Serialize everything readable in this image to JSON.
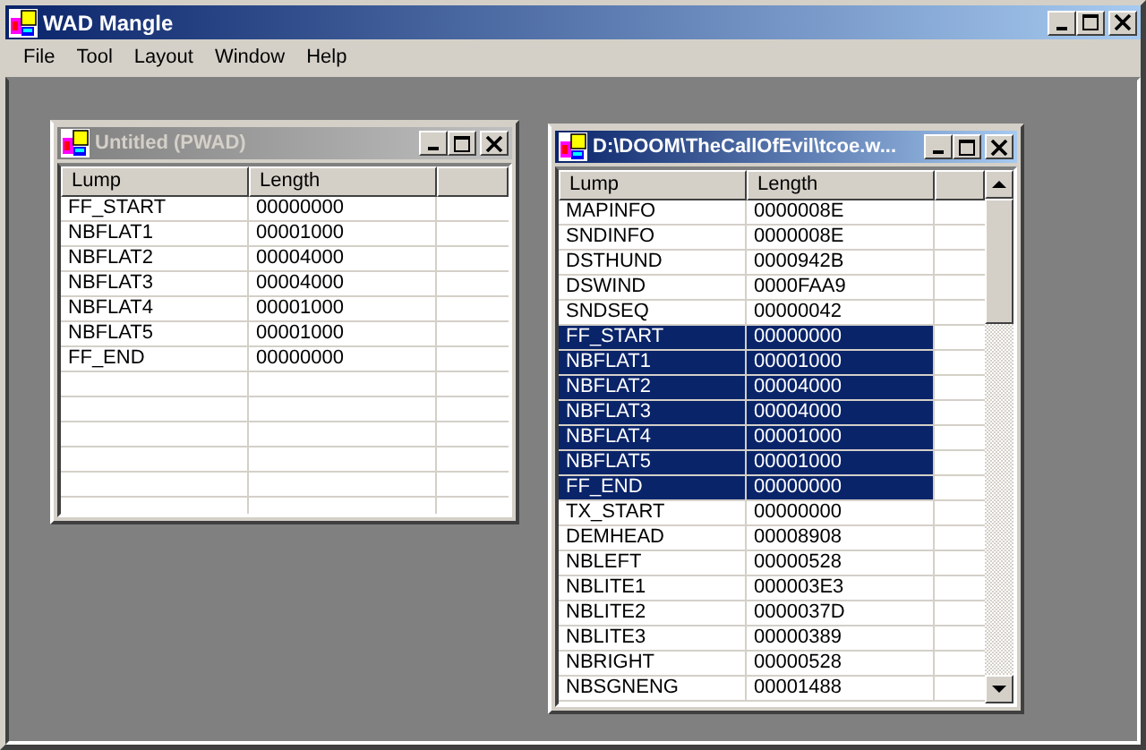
{
  "window": {
    "title": "WAD Mangle"
  },
  "menu": [
    "File",
    "Tool",
    "Layout",
    "Window",
    "Help"
  ],
  "documents": [
    {
      "title": "Untitled (PWAD)",
      "active": false,
      "columns": [
        "Lump",
        "Length"
      ],
      "rows": [
        {
          "lump": "FF_START",
          "length": "00000000",
          "selected": false
        },
        {
          "lump": "NBFLAT1",
          "length": "00001000",
          "selected": false
        },
        {
          "lump": "NBFLAT2",
          "length": "00004000",
          "selected": false
        },
        {
          "lump": "NBFLAT3",
          "length": "00004000",
          "selected": false
        },
        {
          "lump": "NBFLAT4",
          "length": "00001000",
          "selected": false
        },
        {
          "lump": "NBFLAT5",
          "length": "00001000",
          "selected": false
        },
        {
          "lump": "FF_END",
          "length": "00000000",
          "selected": false
        }
      ]
    },
    {
      "title": "D:\\DOOM\\TheCallOfEvil\\tcoe.w...",
      "active": true,
      "columns": [
        "Lump",
        "Length"
      ],
      "rows": [
        {
          "lump": "MAPINFO",
          "length": "0000008E",
          "selected": false
        },
        {
          "lump": "SNDINFO",
          "length": "0000008E",
          "selected": false
        },
        {
          "lump": "DSTHUND",
          "length": "0000942B",
          "selected": false
        },
        {
          "lump": "DSWIND",
          "length": "0000FAA9",
          "selected": false
        },
        {
          "lump": "SNDSEQ",
          "length": "00000042",
          "selected": false
        },
        {
          "lump": "FF_START",
          "length": "00000000",
          "selected": true
        },
        {
          "lump": "NBFLAT1",
          "length": "00001000",
          "selected": true
        },
        {
          "lump": "NBFLAT2",
          "length": "00004000",
          "selected": true
        },
        {
          "lump": "NBFLAT3",
          "length": "00004000",
          "selected": true
        },
        {
          "lump": "NBFLAT4",
          "length": "00001000",
          "selected": true
        },
        {
          "lump": "NBFLAT5",
          "length": "00001000",
          "selected": true
        },
        {
          "lump": "FF_END",
          "length": "00000000",
          "selected": true
        },
        {
          "lump": "TX_START",
          "length": "00000000",
          "selected": false
        },
        {
          "lump": "DEMHEAD",
          "length": "00008908",
          "selected": false
        },
        {
          "lump": "NBLEFT",
          "length": "00000528",
          "selected": false
        },
        {
          "lump": "NBLITE1",
          "length": "000003E3",
          "selected": false
        },
        {
          "lump": "NBLITE2",
          "length": "0000037D",
          "selected": false
        },
        {
          "lump": "NBLITE3",
          "length": "00000389",
          "selected": false
        },
        {
          "lump": "NBRIGHT",
          "length": "00000528",
          "selected": false
        },
        {
          "lump": "NBSGNENG",
          "length": "00001488",
          "selected": false
        }
      ]
    }
  ]
}
